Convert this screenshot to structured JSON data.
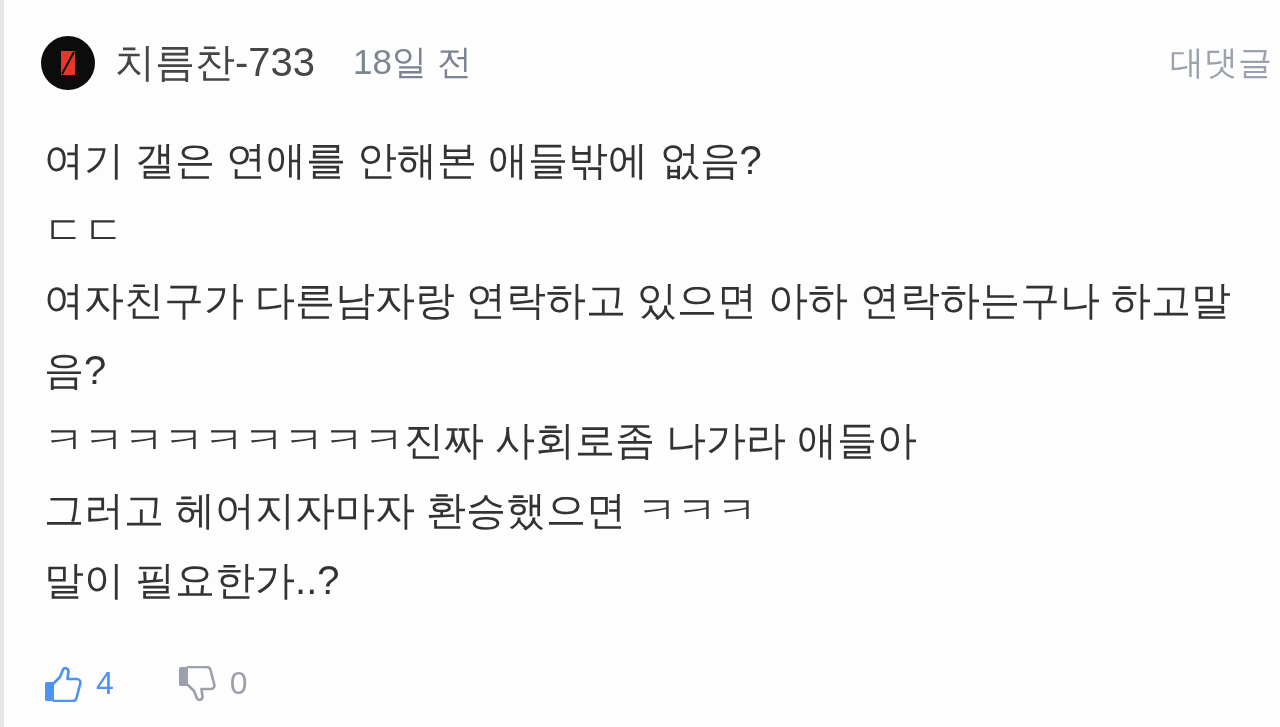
{
  "comment": {
    "author": "치름찬-733",
    "time": "18일 전",
    "reply_button": "대댓글",
    "body_lines": [
      "여기 갤은 연애를 안해본 애들밖에 없음?",
      "ㄷㄷ",
      "여자친구가 다른남자랑 연락하고 있으면 아하 연락하는구나 하고말",
      "음?",
      "ㅋㅋㅋㅋㅋㅋㅋㅋㅋ진짜 사회로좀 나가라 애들아",
      "그러고 헤어지자마자 환승했으면 ㅋㅋㅋ",
      "말이 필요한가..?"
    ],
    "likes": "4",
    "dislikes": "0"
  }
}
